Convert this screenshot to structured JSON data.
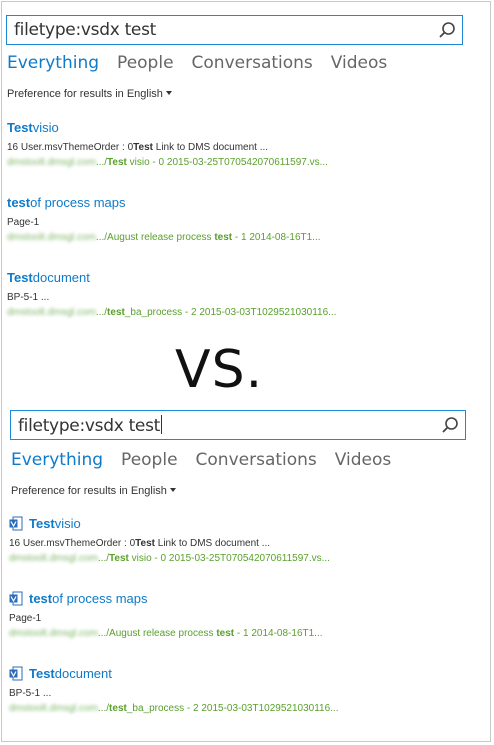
{
  "search": {
    "query": "filetype:vsdx test"
  },
  "tabs": [
    "Everything",
    "People",
    "Conversations",
    "Videos"
  ],
  "preference": {
    "label": "Preference for results in",
    "language": "English"
  },
  "results": [
    {
      "title_bold": "Test",
      "title_rest": " visio",
      "desc_pre": "16 User.msvThemeOrder : 0",
      "desc_bold": "Test",
      "desc_post": " Link to DMS document ...",
      "url_blur": "dmstoolt.dmsgl.com",
      "url_sep": ".../",
      "url_bold": "Test",
      "url_rest": " visio - 0 2015-03-25T070542070611597.vs..."
    },
    {
      "title_bold": "test",
      "title_rest": " of process maps",
      "desc_pre": "Page-1",
      "desc_bold": "",
      "desc_post": "",
      "url_blur": "dmstoolt.dmsgl.com",
      "url_sep": ".../August release process ",
      "url_bold": "test",
      "url_rest": " - 1 2014-08-16T1..."
    },
    {
      "title_bold": "Test",
      "title_rest": " document",
      "desc_pre": "BP-5-1 ...",
      "desc_bold": "",
      "desc_post": "",
      "url_blur": "dmstoolt.dmsgl.com",
      "url_sep": ".../",
      "url_bold": "test",
      "url_rest": "_ba_process - 2 2015-03-03T1029521030116..."
    }
  ],
  "separator": "VS.",
  "colors": {
    "accent": "#0f7ac9",
    "url_green": "#5aa02c",
    "border": "#1e88d6"
  },
  "icons": {
    "search": "search-icon",
    "visio_doc": "visio-file-icon"
  }
}
